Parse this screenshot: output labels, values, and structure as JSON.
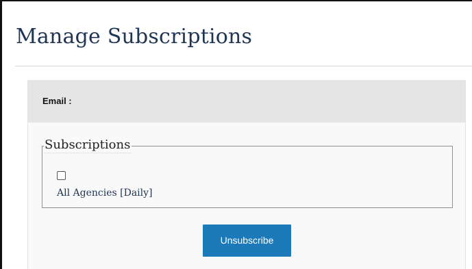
{
  "page": {
    "title": "Manage Subscriptions"
  },
  "form": {
    "email_label": "Email :",
    "subscriptions": {
      "legend": "Subscriptions",
      "options": [
        {
          "label": "All Agencies [Daily]",
          "checked": false
        }
      ]
    },
    "unsubscribe_label": "Unsubscribe"
  },
  "colors": {
    "title": "#1e3553",
    "button": "#1c7ab8",
    "panel_header": "#e5e5e5",
    "panel_body": "#f9f9f9"
  }
}
